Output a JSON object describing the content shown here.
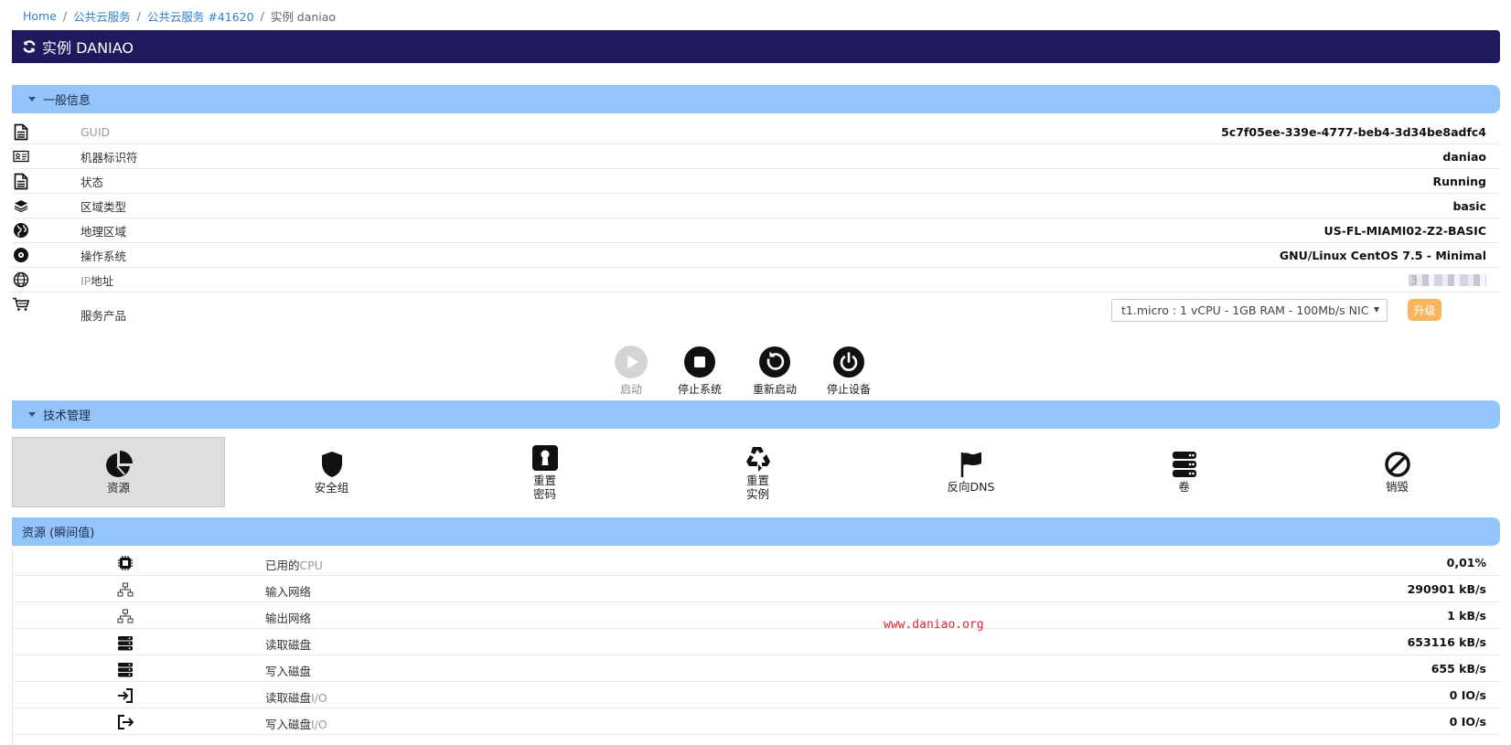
{
  "breadcrumb": {
    "items": [
      "Home",
      "公共云服务",
      "公共云服务 #41620"
    ],
    "current": "实例 daniao"
  },
  "title": "实例 DANIAO",
  "general": {
    "header": "一般信息",
    "rows": [
      {
        "icon": "document-icon",
        "label": "GUID",
        "value": "5c7f05ee-339e-4777-beb4-3d34be8adfc4"
      },
      {
        "icon": "id-card-icon",
        "label": "机器标识符",
        "value": "daniao"
      },
      {
        "icon": "document-icon",
        "label": "状态",
        "value": "Running"
      },
      {
        "icon": "layers-icon",
        "label": "区域类型",
        "value": "basic"
      },
      {
        "icon": "globe-icon",
        "label": "地理区域",
        "value": "US-FL-MIAMI02-Z2-BASIC"
      },
      {
        "icon": "disc-icon",
        "label": "操作系统",
        "value": "GNU/Linux CentOS 7.5 - Minimal"
      },
      {
        "icon": "network-globe-icon",
        "label": "IP地址",
        "value": "3"
      }
    ],
    "product": {
      "label": "服务产品",
      "selected": "t1.micro : 1 vCPU - 1GB RAM - 100Mb/s NIC",
      "upgrade_label": "升级"
    }
  },
  "power_actions": [
    {
      "label": "启动",
      "icon": "play-icon",
      "enabled": false
    },
    {
      "label": "停止系统",
      "icon": "stop-icon",
      "enabled": true
    },
    {
      "label": "重新启动",
      "icon": "restart-icon",
      "enabled": true
    },
    {
      "label": "停止设备",
      "icon": "power-icon",
      "enabled": true
    }
  ],
  "tech": {
    "header": "技术管理",
    "items": [
      {
        "label": "资源",
        "icon": "pie-chart-icon",
        "active": true
      },
      {
        "label": "安全组",
        "icon": "shield-icon"
      },
      {
        "label": "重置\n密码",
        "icon": "keyhole-icon"
      },
      {
        "label": "重置\n实例",
        "icon": "recycle-icon"
      },
      {
        "label": "反向DNS",
        "icon": "flag-icon"
      },
      {
        "label": "卷",
        "icon": "server-icon"
      },
      {
        "label": "销毁",
        "icon": "ban-icon"
      }
    ]
  },
  "resources": {
    "header": "资源 (瞬间值)",
    "rows": [
      {
        "icon": "cpu-icon",
        "label": "已用的",
        "label_suffix": "CPU",
        "value": "0,01%"
      },
      {
        "icon": "sitemap-icon",
        "label": "输入网络",
        "label_suffix": "",
        "value": "290901 kB/s"
      },
      {
        "icon": "sitemap-icon",
        "label": "输出网络",
        "label_suffix": "",
        "value": "1 kB/s"
      },
      {
        "icon": "server-icon",
        "label": "读取磁盘",
        "label_suffix": "",
        "value": "653116 kB/s"
      },
      {
        "icon": "server-icon",
        "label": "写入磁盘",
        "label_suffix": "",
        "value": "655 kB/s"
      },
      {
        "icon": "sign-in-icon",
        "label": "读取磁盘",
        "label_suffix": "I/O",
        "value": "0 IO/s"
      },
      {
        "icon": "sign-out-icon",
        "label": "写入磁盘",
        "label_suffix": "I/O",
        "value": "0 IO/s"
      }
    ]
  },
  "watermark": "www.daniao.org"
}
